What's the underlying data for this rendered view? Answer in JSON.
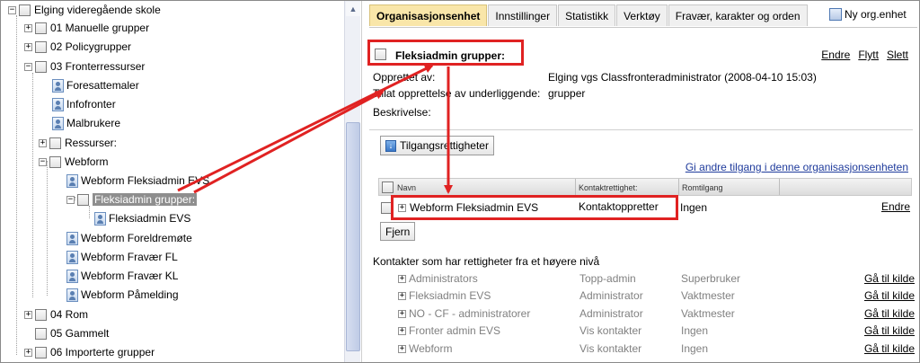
{
  "tree": {
    "items": [
      {
        "label": "Elging videregående skole",
        "icon": "checkbox",
        "pm": "minus"
      },
      {
        "label": "01 Manuelle grupper",
        "icon": "checkbox",
        "pm": "plus"
      },
      {
        "label": "02 Policygrupper",
        "icon": "checkbox",
        "pm": "plus"
      },
      {
        "label": "03 Fronterressurser",
        "icon": "checkbox",
        "pm": "minus"
      },
      {
        "label": "Foresattemaler",
        "icon": "user-group-icon"
      },
      {
        "label": "Infofronter",
        "icon": "user-group-icon"
      },
      {
        "label": "Malbrukere",
        "icon": "user-group-icon"
      },
      {
        "label": "Ressurser:",
        "icon": "checkbox",
        "pm": "plus"
      },
      {
        "label": "Webform",
        "icon": "checkbox",
        "pm": "minus"
      },
      {
        "label": "Webform Fleksiadmin EVS",
        "icon": "user-group-icon"
      },
      {
        "label": "Fleksiadmin grupper:",
        "icon": "checkbox",
        "pm": "minus",
        "selected": true
      },
      {
        "label": "Fleksiadmin EVS",
        "icon": "user-group-icon"
      },
      {
        "label": "Webform Foreldremøte",
        "icon": "user-group-icon"
      },
      {
        "label": "Webform Fravær FL",
        "icon": "user-group-icon"
      },
      {
        "label": "Webform Fravær KL",
        "icon": "user-group-icon"
      },
      {
        "label": "Webform Påmelding",
        "icon": "user-group-icon"
      },
      {
        "label": "04 Rom",
        "icon": "checkbox",
        "pm": "plus"
      },
      {
        "label": "05 Gammelt",
        "icon": "checkbox"
      },
      {
        "label": "06 Importerte grupper",
        "icon": "checkbox",
        "pm": "plus"
      }
    ]
  },
  "tabs": [
    {
      "label": "Organisasjonsenhet",
      "active": true
    },
    {
      "label": "Innstillinger"
    },
    {
      "label": "Statistikk"
    },
    {
      "label": "Verktøy"
    },
    {
      "label": "Fravær, karakter og orden"
    }
  ],
  "new_unit_label": "Ny org.enhet",
  "unit": {
    "title": "Fleksiadmin grupper:",
    "actions": {
      "edit": "Endre",
      "move": "Flytt",
      "delete": "Slett"
    },
    "created_by_label": "Opprettet av:",
    "created_by_value": "Elging vgs Classfronteradministrator (2008-04-10 15:03)",
    "allowed_label": "Tillat opprettelse av underliggende:",
    "allowed_value": "grupper",
    "description_label": "Beskrivelse:"
  },
  "access": {
    "button_label": "Tilgangsrettigheter",
    "give_access_link": "Gi andre tilgang i denne organisasjonsenheten",
    "columns": {
      "name": "Navn",
      "contact_right": "Kontaktrettighet:",
      "room_access": "Romtilgang"
    },
    "row": {
      "name": "Webform Fleksiadmin EVS",
      "contact_right": "Kontaktoppretter",
      "room_access": "Ingen",
      "edit": "Endre"
    },
    "remove_button": "Fjern"
  },
  "inherited": {
    "title": "Kontakter som har rettigheter fra et høyere nivå",
    "rows": [
      {
        "name": "Administrators",
        "contact_right": "Topp-admin",
        "room_access": "Superbruker",
        "link": "Gå til kilde"
      },
      {
        "name": "Fleksiadmin EVS",
        "contact_right": "Administrator",
        "room_access": "Vaktmester",
        "link": "Gå til kilde"
      },
      {
        "name": "NO - CF - administratorer",
        "contact_right": "Administrator",
        "room_access": "Vaktmester",
        "link": "Gå til kilde"
      },
      {
        "name": "Fronter admin EVS",
        "contact_right": "Vis kontakter",
        "room_access": "Ingen",
        "link": "Gå til kilde"
      },
      {
        "name": "Webform",
        "contact_right": "Vis kontakter",
        "room_access": "Ingen",
        "link": "Gå til kilde"
      }
    ]
  },
  "colors": {
    "annotation_red": "#e02222",
    "active_tab": "#f9e6a9",
    "selected_item": "#8e8e8e"
  }
}
